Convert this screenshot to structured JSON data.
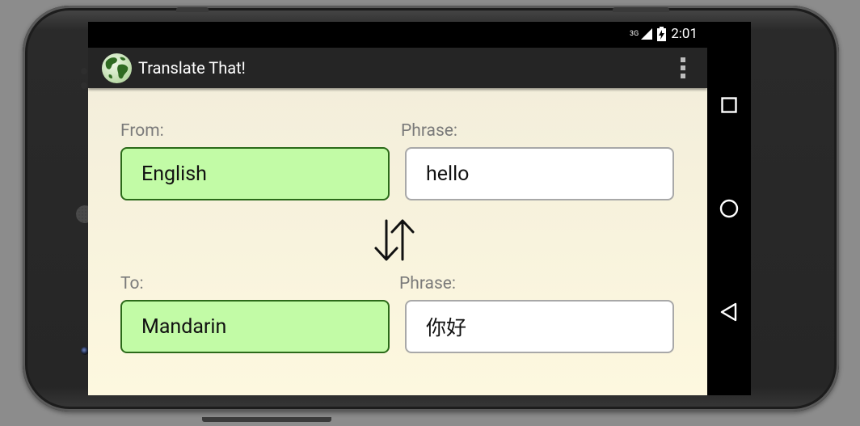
{
  "status_bar": {
    "network": "3G",
    "time": "2:01",
    "icons": [
      "signal-icon",
      "battery-charging-icon"
    ]
  },
  "action_bar": {
    "app_icon": "globe-icon",
    "title": "Translate That!",
    "menu_icon": "overflow-menu-icon"
  },
  "from": {
    "label": "From:",
    "language": "English",
    "phrase_label": "Phrase:",
    "phrase": "hello"
  },
  "swap_icon": "swap-arrows-icon",
  "to": {
    "label": "To:",
    "language": "Mandarin",
    "phrase_label": "Phrase:",
    "phrase": "你好"
  },
  "nav_bar": {
    "buttons": [
      "recent-apps-icon",
      "home-icon",
      "back-icon"
    ]
  },
  "colors": {
    "language_field_bg": "#c2fba6",
    "language_field_border": "#2b6a19",
    "content_bg": "#fdf8df",
    "action_bar_bg": "#252525"
  }
}
